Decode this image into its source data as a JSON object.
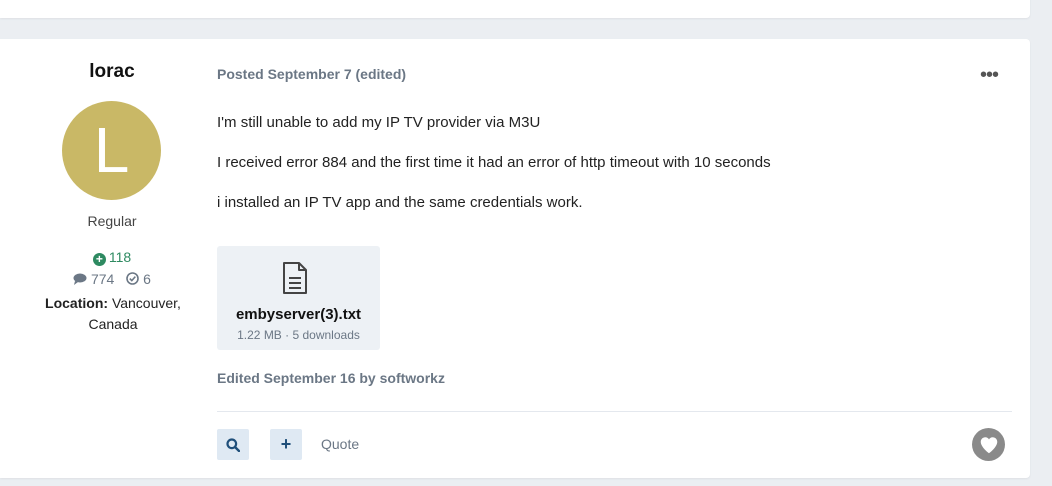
{
  "post": {
    "author": {
      "name": "lorac",
      "avatar_letter": "L",
      "avatar_color": "#c9b866",
      "rank": "Regular",
      "reputation": "118",
      "posts_count": "774",
      "solutions_count": "6",
      "location_label": "Location:",
      "location_value": "Vancouver, Canada"
    },
    "meta": {
      "posted": "Posted September 7",
      "edited_flag": "(edited)"
    },
    "more_label": "•••",
    "paragraphs": [
      "I'm still unable to add my IP TV provider via M3U",
      "I received error 884 and the first time it had an error of http timeout with 10 seconds",
      "i installed an IP TV app and the same credentials work."
    ],
    "attachment": {
      "name": "embyserver(3).txt",
      "info": "1.22 MB · 5 downloads",
      "icon": "file-text-icon"
    },
    "edited_note": "Edited September 16 by softworkz",
    "actions": {
      "search_icon": "search-icon",
      "add_icon": "plus-icon",
      "quote_label": "Quote",
      "reaction_icon": "heart-icon"
    }
  }
}
